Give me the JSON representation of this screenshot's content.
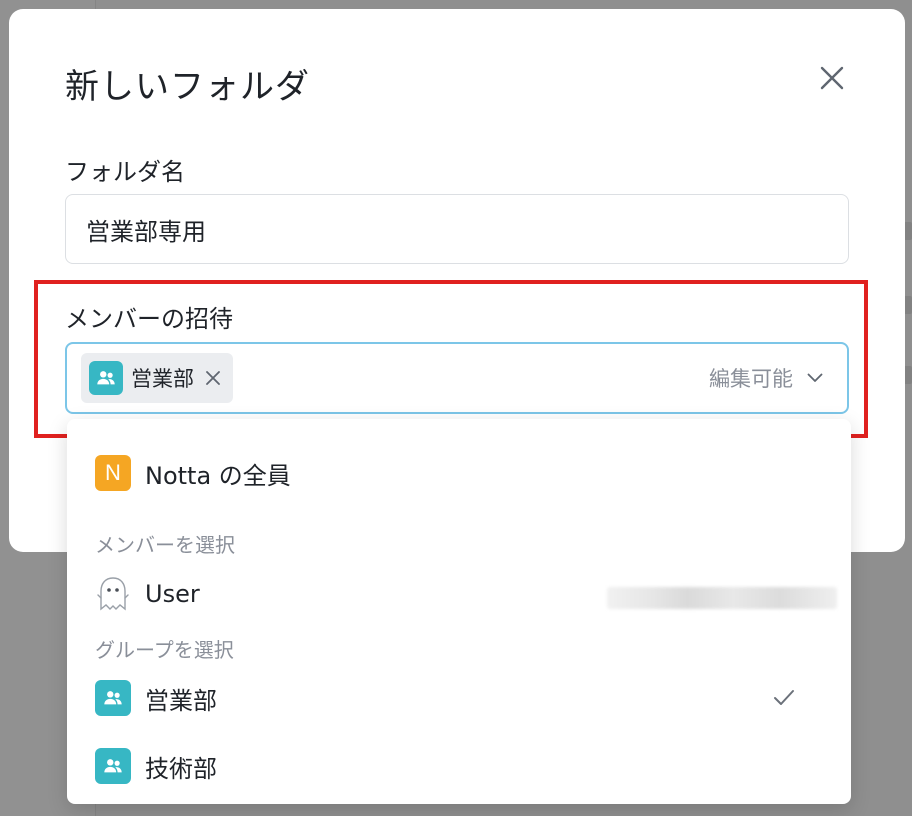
{
  "modal": {
    "title": "新しいフォルダ",
    "folder_name_label": "フォルダ名",
    "folder_name_value": "営業部専用",
    "invite_label": "メンバーの招待",
    "selected_chip": "営業部",
    "permission": "編集可能"
  },
  "dropdown": {
    "everyone": {
      "initial": "N",
      "label": "Notta の全員"
    },
    "members_section": "メンバーを選択",
    "members": [
      {
        "name": "User"
      }
    ],
    "groups_section": "グループを選択",
    "groups": [
      {
        "name": "営業部",
        "selected": true
      },
      {
        "name": "技術部",
        "selected": false
      }
    ]
  },
  "colors": {
    "group_icon": "#37b7c4",
    "everyone_avatar": "#f5a623",
    "focus_border": "#7cc6e8",
    "annotation": "#e0211f"
  }
}
